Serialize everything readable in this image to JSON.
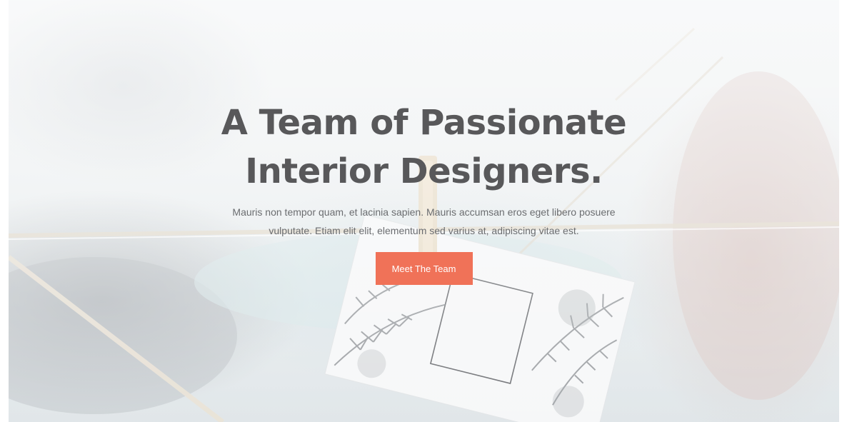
{
  "hero": {
    "title_line1": "A Team of Passionate",
    "title_line2": "Interior Designers.",
    "subtitle": "Mauris non tempor quam, et lacinia sapien. Mauris accumsan eros eget libero posuere vulputate. Etiam elit elit, elementum sed varius at, adipiscing vitae est.",
    "cta_label": "Meet The Team"
  },
  "colors": {
    "accent": "#f07258",
    "heading": "#58585a",
    "body_text": "#6b6d70"
  }
}
